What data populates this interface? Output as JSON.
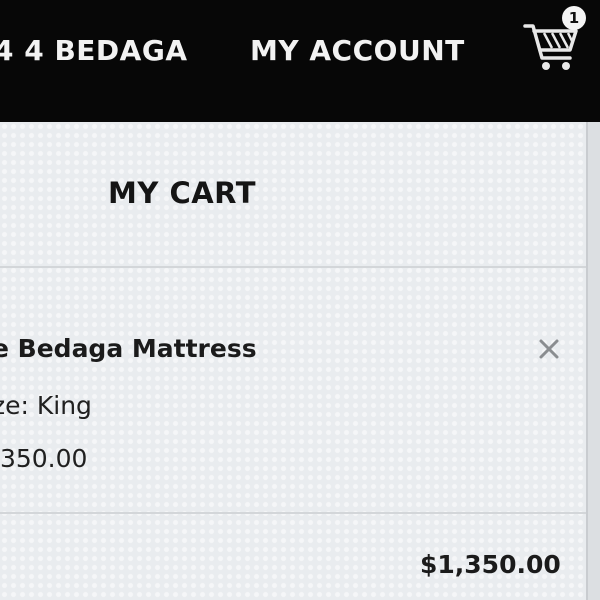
{
  "header": {
    "brand_label": "4 4 BEDAGA",
    "account_label": "MY ACCOUNT",
    "cart": {
      "icon": "shopping-cart-icon",
      "count": "1"
    }
  },
  "cart_drawer": {
    "title": "MY CART",
    "items": [
      {
        "name": "e Bedaga Mattress",
        "size": "ze: King",
        "price": ",350.00",
        "remove_icon": "close-icon"
      }
    ],
    "subtotal": "$1,350.00"
  },
  "colors": {
    "header_bg": "#070707",
    "header_text": "#f2f2f2",
    "drawer_bg": "#e9ecef",
    "text_dark": "#1b1b1b",
    "icon_gray": "#8a8d90"
  }
}
